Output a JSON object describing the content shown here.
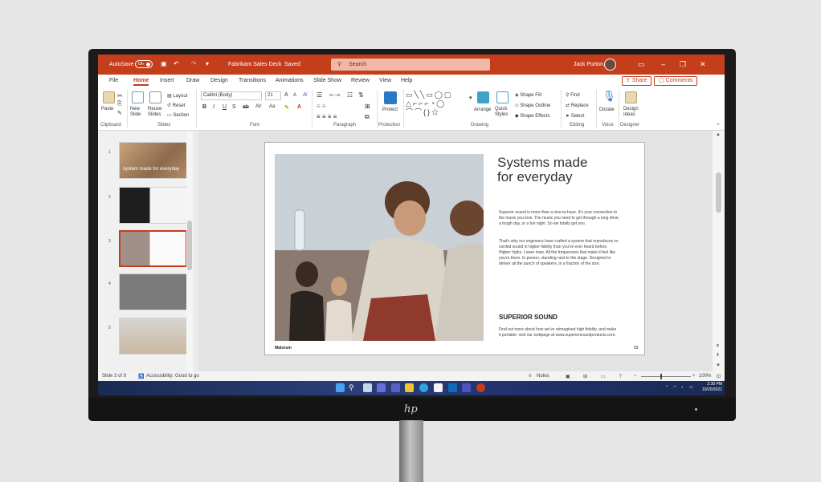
{
  "titlebar": {
    "autosave_label": "AutoSave",
    "autosave_state": "On",
    "doc_title": "Fabrikam Sales Deck",
    "saved_label": "Saved",
    "search_placeholder": "Search",
    "user_name": "Jack Purton"
  },
  "tabs": [
    "File",
    "Home",
    "Insert",
    "Draw",
    "Design",
    "Transitions",
    "Animations",
    "Slide Show",
    "Review",
    "View",
    "Help"
  ],
  "active_tab": "Home",
  "share_label": "Share",
  "comments_label": "Comments",
  "ribbon": {
    "clipboard": {
      "paste": "Paste",
      "label": "Clipboard"
    },
    "slides": {
      "new_slide": "New Slide",
      "reuse_slides": "Reuse Slides",
      "layout": "Layout",
      "reset": "Reset",
      "section": "Section",
      "label": "Slides"
    },
    "font": {
      "font_name": "Calibri (Body)",
      "font_size": "21",
      "label": "Font"
    },
    "paragraph": {
      "label": "Paragraph"
    },
    "protection": {
      "protect": "Protect",
      "label": "Protection"
    },
    "drawing": {
      "arrange": "Arrange",
      "quick_styles": "Quick Styles",
      "shape_fill": "Shape Fill",
      "shape_outline": "Shape Outline",
      "shape_effects": "Shape Effects",
      "label": "Drawing"
    },
    "editing": {
      "find": "Find",
      "replace": "Replace",
      "select": "Select",
      "label": "Editing"
    },
    "voice": {
      "dictate": "Dictate",
      "label": "Voice"
    },
    "designer": {
      "design_ideas": "Design Ideas",
      "label": "Designer"
    }
  },
  "thumbnails": [
    {
      "num": "1",
      "text": "system made for everyday"
    },
    {
      "num": "2",
      "text": ""
    },
    {
      "num": "3",
      "text": ""
    },
    {
      "num": "4",
      "text": ""
    },
    {
      "num": "5",
      "text": ""
    }
  ],
  "slide": {
    "title_line1": "Systems made",
    "title_line2": "for everyday",
    "para1": "Superior sound is more than a nice-to-have. It's your connection to the music you love. The music you need to get through a long drive, a tough day, or a fun night. So we totally get you.",
    "para2": "That's why our engineers have crafted a system that reproduces re-corded sound in higher fidelity than you've ever heard before. Higher highs. Lower lows. All the frequencies that make it feel like you're there. In person, standing next to the stage. Designed to deliver all the punch of speakers, in a fraction of the size.",
    "heading": "SUPERIOR SOUND",
    "para3": "Find out more about how we've reimagined high fidelity, and make it portable: visit our webpage at www.superiorsoundproducts.com.",
    "footer_left": "Malorum",
    "footer_right": "03"
  },
  "status": {
    "slide_info": "Slide 3 of 9",
    "accessibility": "Accessibility: Good to go",
    "notes": "Notes",
    "zoom": "100%"
  },
  "taskbar": {
    "time": "2:30 PM",
    "date": "10/20/2021"
  },
  "colors": {
    "accent": "#c43e1c",
    "taskbar": "#1f2f62"
  }
}
